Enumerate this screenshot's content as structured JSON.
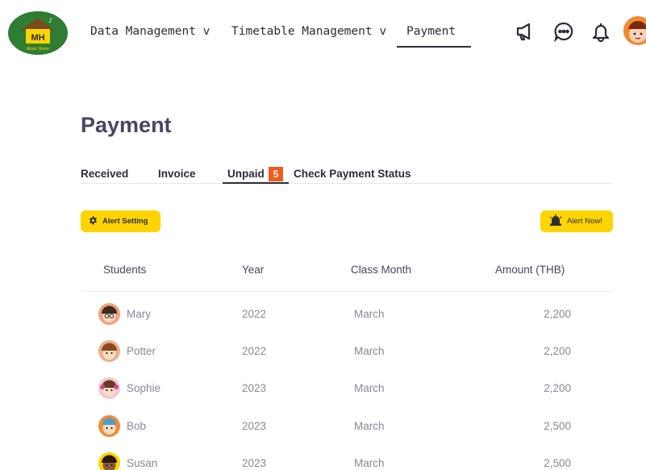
{
  "logo": {
    "text": "MH",
    "subtext": "Music Home"
  },
  "nav": {
    "items": [
      {
        "label": "Data Management v"
      },
      {
        "label": "Timetable Management v"
      },
      {
        "label": "Payment"
      }
    ],
    "active": "Payment",
    "icons": [
      "megaphone-icon",
      "chat-icon",
      "bell-icon"
    ]
  },
  "page": {
    "title": "Payment"
  },
  "tabs": {
    "items": [
      {
        "label": "Received"
      },
      {
        "label": "Invoice"
      },
      {
        "label": "Unpaid"
      },
      {
        "label": "Check Payment Status"
      }
    ],
    "active": "Unpaid",
    "unpaid_count": "5"
  },
  "buttons": {
    "alert_setting": "Alert Setting",
    "alert_now": "Alert Now!"
  },
  "table": {
    "headers": [
      "Students",
      "Year",
      "Class Month",
      "Amount (THB)"
    ],
    "rows": [
      {
        "name": "Mary",
        "year": "2022",
        "month": "March",
        "amount": "2,200",
        "avatar_color": "#f2a07a"
      },
      {
        "name": "Potter",
        "year": "2022",
        "month": "March",
        "amount": "2,200",
        "avatar_color": "#e9b28f"
      },
      {
        "name": "Sophie",
        "year": "2023",
        "month": "March",
        "amount": "2,200",
        "avatar_color": "#f4c6d8"
      },
      {
        "name": "Bob",
        "year": "2023",
        "month": "March",
        "amount": "2,500",
        "avatar_color": "#f28a30"
      },
      {
        "name": "Susan",
        "year": "2023",
        "month": "March",
        "amount": "2,500",
        "avatar_color": "#ffd400"
      }
    ]
  },
  "colors": {
    "accent": "#ffd400",
    "badge": "#f05a1a",
    "logo_bg": "#2e7d32"
  }
}
